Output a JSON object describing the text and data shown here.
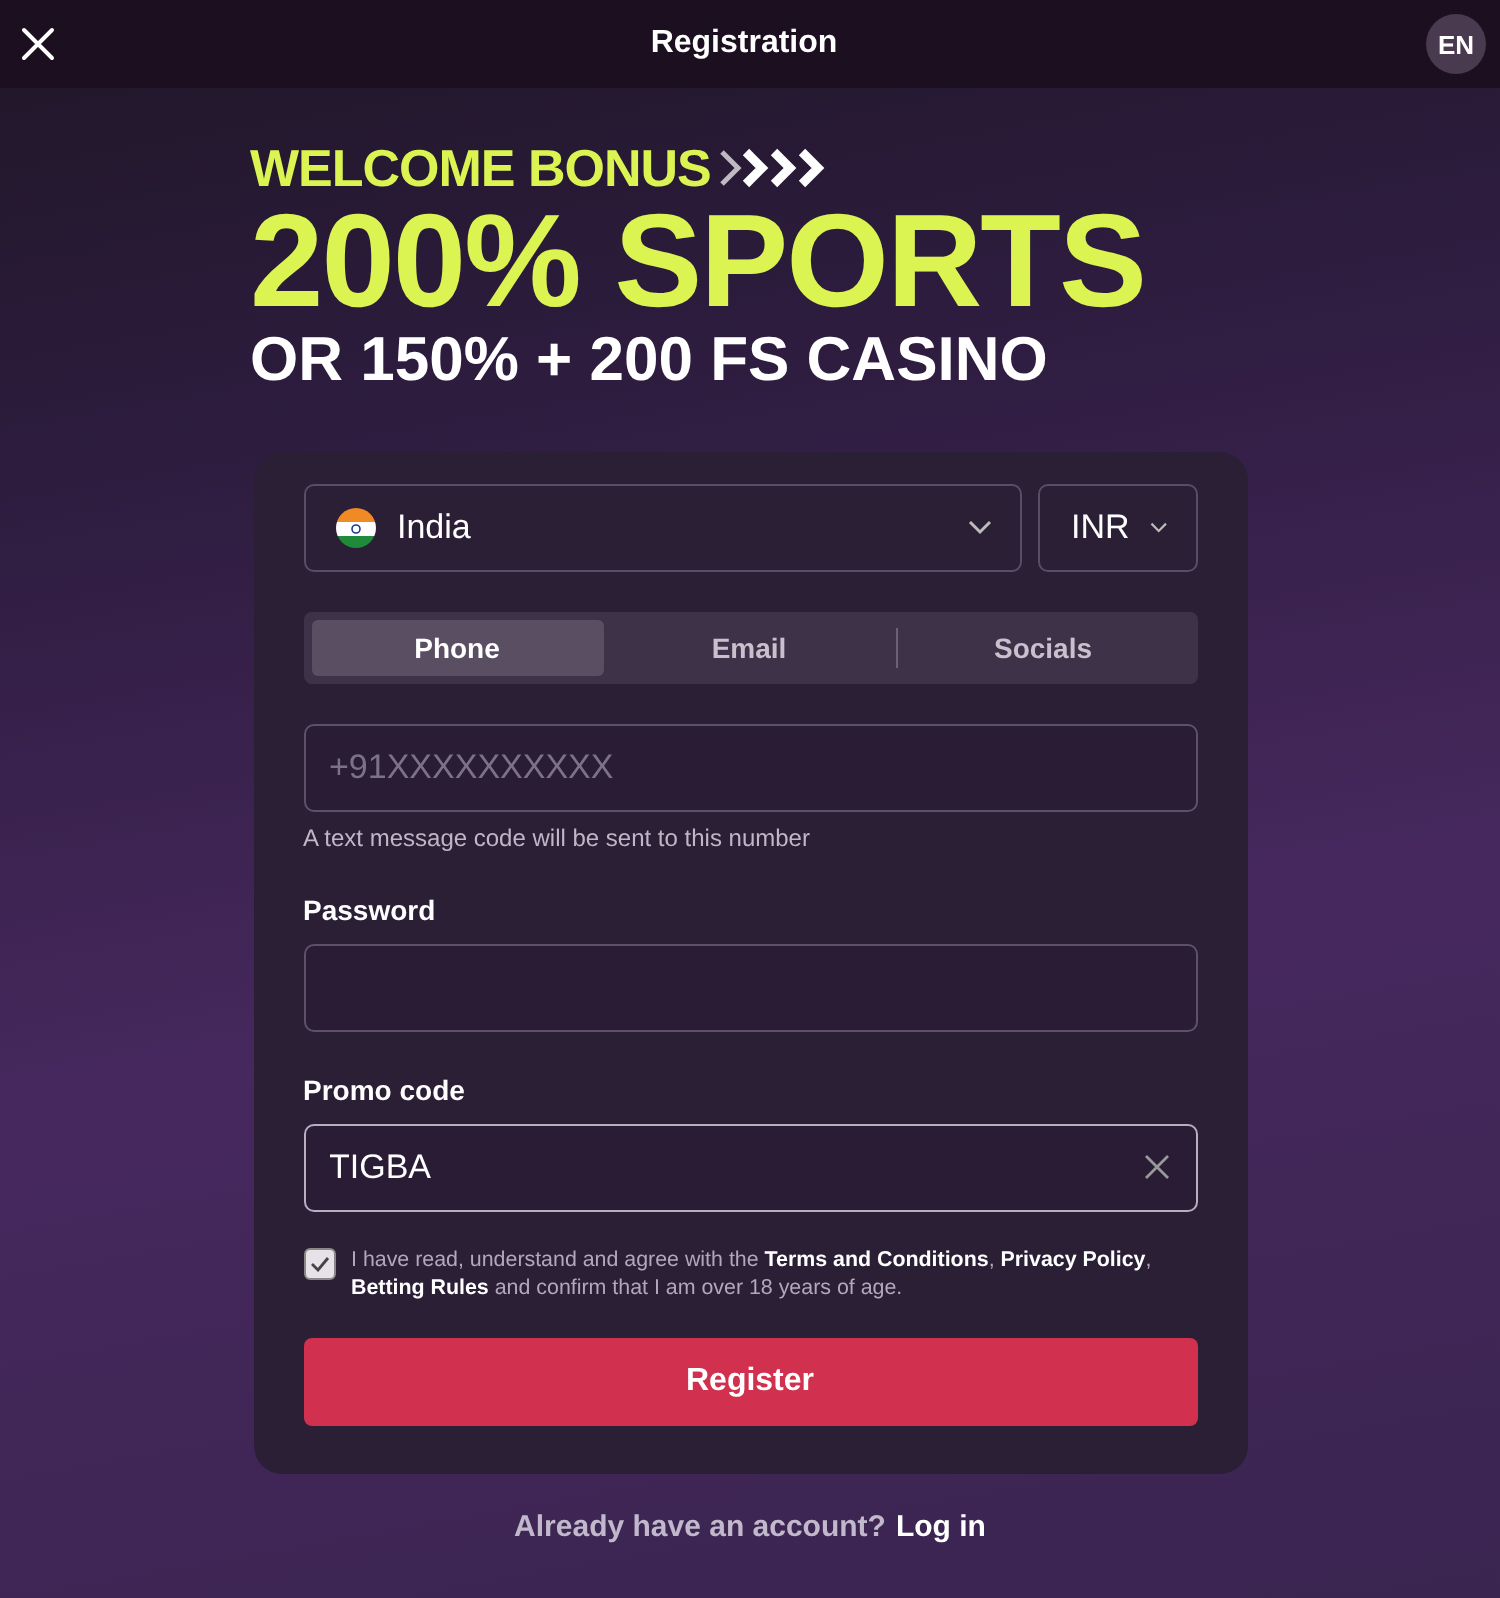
{
  "header": {
    "title": "Registration",
    "language": "EN"
  },
  "promo": {
    "eyebrow": "WELCOME BONUS",
    "headline": "200% SPORTS",
    "subline": "OR 150% + 200 FS CASINO"
  },
  "country": {
    "value": "India"
  },
  "currency": {
    "value": "INR"
  },
  "tabs": [
    {
      "label": "Phone",
      "selected": true
    },
    {
      "label": "Email",
      "selected": false
    },
    {
      "label": "Socials",
      "selected": false
    }
  ],
  "phone": {
    "placeholder": "+91XXXXXXXXXX",
    "hint": "A text message code will be sent to this number"
  },
  "password": {
    "label": "Password"
  },
  "promo_code": {
    "label": "Promo code",
    "value": "TIGBA"
  },
  "consent": {
    "checked": true,
    "parts": [
      {
        "kind": "text",
        "text": "I have read, understand and agree with the "
      },
      {
        "kind": "link",
        "text": "Terms and Conditions"
      },
      {
        "kind": "text",
        "text": ", "
      },
      {
        "kind": "link",
        "text": "Privacy Policy"
      },
      {
        "kind": "text",
        "text": ", "
      },
      {
        "kind": "link",
        "text": "Betting Rules"
      },
      {
        "kind": "text",
        "text": " and confirm that I am over 18 years of age."
      }
    ]
  },
  "register_button": "Register",
  "login_prompt": {
    "text": "Already have an account?",
    "link": "Log in"
  }
}
